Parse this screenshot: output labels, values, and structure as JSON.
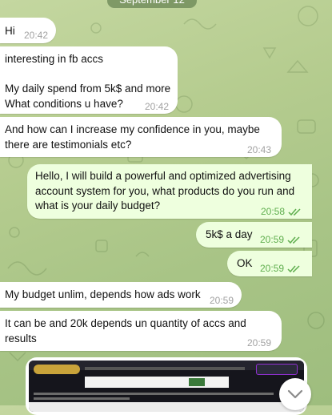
{
  "date_label": "September 12",
  "messages": [
    {
      "text": "Hi",
      "time": "20:42"
    },
    {
      "text": "interesting in fb accs\n\nMy daily spend from 5k$ and more\nWhat conditions u have?",
      "time": "20:42"
    },
    {
      "text": "And how can I increase my confidence in you, maybe\nthere are testimonials etc?",
      "time": "20:43"
    },
    {
      "text": "Hello, I will build a powerful and optimized advertising\naccount system for you, what products do you run and\nwhat is your daily budget?",
      "time": "20:58"
    },
    {
      "text": "5k$ a day",
      "time": "20:59"
    },
    {
      "text": "OK",
      "time": "20:59"
    },
    {
      "text": "My budget unlim, depends how ads work",
      "time": "20:59"
    },
    {
      "text": "It can be and 20k depends un quantity of accs and\nresults",
      "time": "20:59"
    }
  ],
  "icons": {
    "read_receipt": "double-check-icon",
    "scroll_down": "chevron-down-icon"
  },
  "colors": {
    "incoming_bubble": "#ffffff",
    "outgoing_bubble": "#eeffde",
    "outgoing_time": "#5fae4e",
    "incoming_time": "#a2a2a2",
    "wallpaper": "#b5cc8f"
  }
}
